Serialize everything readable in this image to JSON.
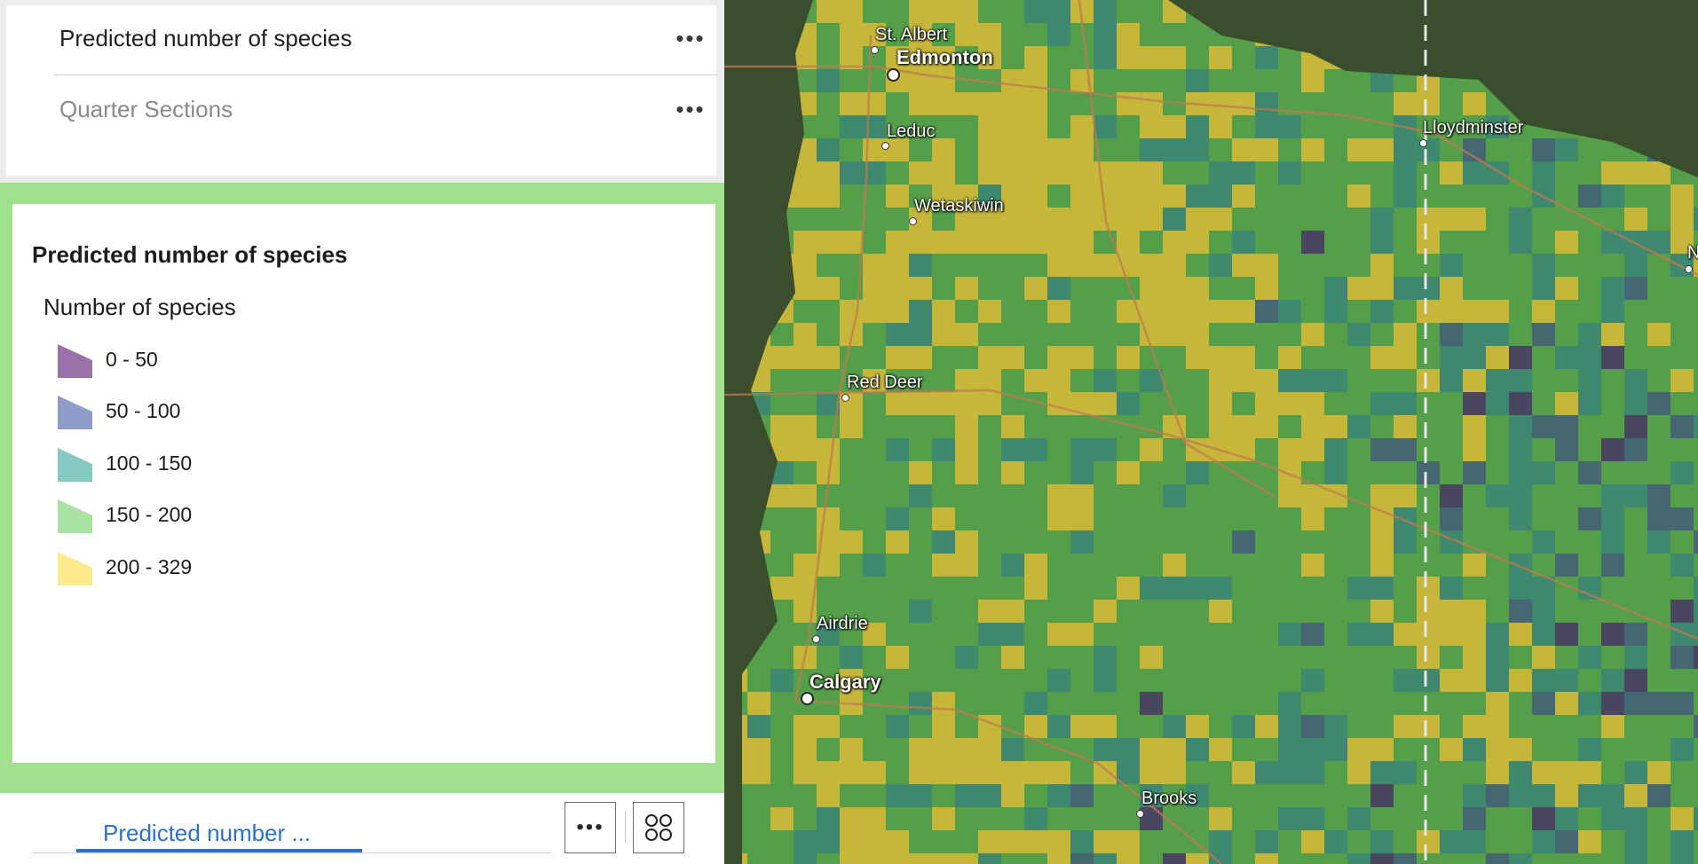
{
  "layers": [
    {
      "label": "Predicted number of species",
      "menu": "•••"
    },
    {
      "label": "Quarter Sections",
      "menu": "•••"
    }
  ],
  "legend": {
    "title": "Predicted number of species",
    "subtitle": "Number of species",
    "items": [
      {
        "label": "0 - 50",
        "color": "#9a71a9"
      },
      {
        "label": "50 - 100",
        "color": "#8d9dc7"
      },
      {
        "label": "100 - 150",
        "color": "#85c9c1"
      },
      {
        "label": "150 - 200",
        "color": "#a9e3a3"
      },
      {
        "label": "200 - 329",
        "color": "#fce98b"
      }
    ]
  },
  "tabbar": {
    "active_tab": "Predicted number ...",
    "more_label": "•••",
    "apps_icon": "grid-circles-icon"
  },
  "map": {
    "colors": {
      "yellow": "#d6c23c",
      "green": "#5aa94e",
      "teal": "#3f8f78",
      "blue": "#466a7a",
      "purple": "#4c4666",
      "satellite": "#3a4d2c"
    },
    "cities": [
      {
        "name": "St. Albert"
      },
      {
        "name": "Edmonton"
      },
      {
        "name": "Leduc"
      },
      {
        "name": "Lloydminster"
      },
      {
        "name": "Wetaskiwin"
      },
      {
        "name": "Red Deer"
      },
      {
        "name": "Airdrie"
      },
      {
        "name": "Calgary"
      },
      {
        "name": "Brooks"
      },
      {
        "name": "N"
      }
    ]
  }
}
